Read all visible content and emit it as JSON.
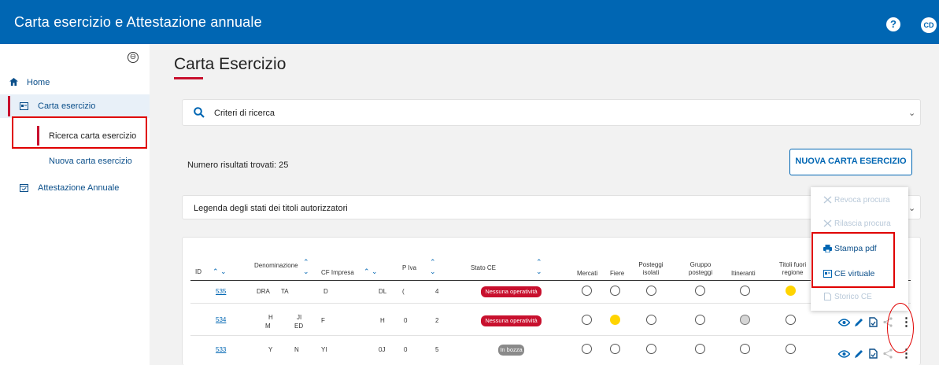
{
  "app": {
    "title": "Carta esercizio e Attestazione annuale",
    "help_icon": "?",
    "user_initials": "CD"
  },
  "sidebar": {
    "collapse_icon": "⊖",
    "home": "Home",
    "carta_esercizio": "Carta esercizio",
    "ricerca": "Ricerca carta esercizio",
    "nuova": "Nuova carta esercizio",
    "attestazione": "Attestazione Annuale"
  },
  "page": {
    "title": "Carta Esercizio",
    "criteri": "Criteri di ricerca",
    "results": "Numero risultati trovati: 25",
    "new_button": "NUOVA CARTA ESERCIZIO",
    "legenda": "Legenda degli stati dei titoli autorizzatori"
  },
  "table": {
    "headers": {
      "id": "ID",
      "denominazione": "Denominazione",
      "cf": "CF Impresa",
      "piva": "P Iva",
      "stato": "Stato CE",
      "mercati": "Mercati",
      "fiere": "Fiere",
      "posteggi_isolati_1": "Posteggi",
      "posteggi_isolati_2": "isolati",
      "gruppo_posteggi_1": "Gruppo",
      "gruppo_posteggi_2": "posteggi",
      "itineranti": "Itineranti",
      "titoli_fuori_1": "Titoli fuori",
      "titoli_fuori_2": "regione"
    },
    "rows": [
      {
        "id": "535",
        "den1": "DRA",
        "den2": "TA",
        "cf1": "D",
        "cf2": "DL",
        "piva1": "(",
        "piva2": "4",
        "stato": "Nessuna operatività",
        "stato_color": "#c8102e",
        "status": [
          "empty",
          "empty",
          "empty",
          "empty",
          "empty",
          "yellow"
        ]
      },
      {
        "id": "534",
        "den1": "H",
        "den2": "JI",
        "den3": "M",
        "den4": "ED",
        "cf1": "F",
        "cf2": "H",
        "piva1": "0",
        "piva2": "2",
        "stato": "Nessuna operatività",
        "stato_color": "#c8102e",
        "status": [
          "empty",
          "yellow",
          "empty",
          "empty",
          "grey",
          "empty"
        ]
      },
      {
        "id": "533",
        "den1": "Y",
        "den2": "N",
        "cf1": "YI",
        "cf2": "0J",
        "piva1": "0",
        "piva2": "5",
        "stato": "In bozza",
        "stato_color": "#8a8a8a",
        "status": [
          "empty",
          "empty",
          "empty",
          "empty",
          "empty",
          "empty"
        ]
      }
    ]
  },
  "context_menu": {
    "revoca": "Revoca procura",
    "rilascia": "Rilascia procura",
    "stampa": "Stampa pdf",
    "ce_virtuale": "CE virtuale",
    "storico": "Storico CE"
  }
}
